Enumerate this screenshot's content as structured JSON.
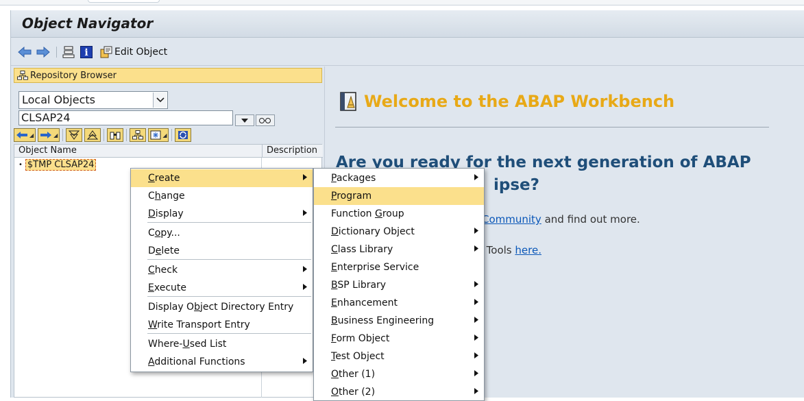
{
  "window": {
    "title": "Object Navigator"
  },
  "toolbar": {
    "edit_object_label": "Edit Object"
  },
  "repository": {
    "header": "Repository Browser",
    "dropdown_value": "Local Objects",
    "object_field": "CLSAP24",
    "tree_columns": [
      "Object Name",
      "Description"
    ],
    "tree_node": "$TMP CLSAP24"
  },
  "welcome": {
    "title": "Welcome to the ABAP Workbench",
    "headline_line1": "Are you ready for the next generation of ABAP",
    "headline_line2": "ipse?",
    "para1_link": "Community",
    "para1_text": "and find out more.",
    "para2_text": "t Tools",
    "para2_link": "here."
  },
  "context_menu": {
    "items": [
      {
        "pre": "",
        "u": "C",
        "post": "reate",
        "submenu": true
      },
      {
        "pre": "C",
        "u": "h",
        "post": "ange",
        "submenu": false
      },
      {
        "pre": "",
        "u": "D",
        "post": "isplay",
        "submenu": true
      },
      {
        "pre": "C",
        "u": "o",
        "post": "py...",
        "submenu": false
      },
      {
        "pre": "D",
        "u": "e",
        "post": "lete",
        "submenu": false
      },
      {
        "pre": "",
        "u": "C",
        "post": "heck",
        "submenu": true
      },
      {
        "pre": "",
        "u": "E",
        "post": "xecute",
        "submenu": true
      },
      {
        "pre": "Display O",
        "u": "b",
        "post": "ject Directory Entry",
        "submenu": false
      },
      {
        "pre": "",
        "u": "W",
        "post": "rite Transport Entry",
        "submenu": false
      },
      {
        "pre": "Where-",
        "u": "U",
        "post": "sed List",
        "submenu": false
      },
      {
        "pre": "",
        "u": "A",
        "post": "dditional Functions",
        "submenu": true
      }
    ]
  },
  "create_submenu": {
    "items": [
      {
        "pre": "",
        "u": "P",
        "post": "ackages",
        "submenu": true
      },
      {
        "pre": "",
        "u": "P",
        "post": "rogram",
        "submenu": false
      },
      {
        "pre": "Function ",
        "u": "G",
        "post": "roup",
        "submenu": false
      },
      {
        "pre": "",
        "u": "D",
        "post": "ictionary Object",
        "submenu": true
      },
      {
        "pre": "",
        "u": "C",
        "post": "lass Library",
        "submenu": true
      },
      {
        "pre": "",
        "u": "E",
        "post": "nterprise Service",
        "submenu": false
      },
      {
        "pre": "",
        "u": "B",
        "post": "SP Library",
        "submenu": true
      },
      {
        "pre": "",
        "u": "E",
        "post": "nhancement",
        "submenu": true
      },
      {
        "pre": "",
        "u": "B",
        "post": "usiness Engineering",
        "submenu": true
      },
      {
        "pre": "",
        "u": "F",
        "post": "orm Object",
        "submenu": true
      },
      {
        "pre": "",
        "u": "T",
        "post": "est Object",
        "submenu": true
      },
      {
        "pre": "",
        "u": "O",
        "post": "ther (1)",
        "submenu": true
      },
      {
        "pre": "",
        "u": "O",
        "post": "ther (2)",
        "submenu": true
      }
    ]
  },
  "colors": {
    "accent": "#e8a917",
    "highlight": "#fbe08c",
    "headline": "#1f4e79",
    "link": "#0a57b8"
  }
}
